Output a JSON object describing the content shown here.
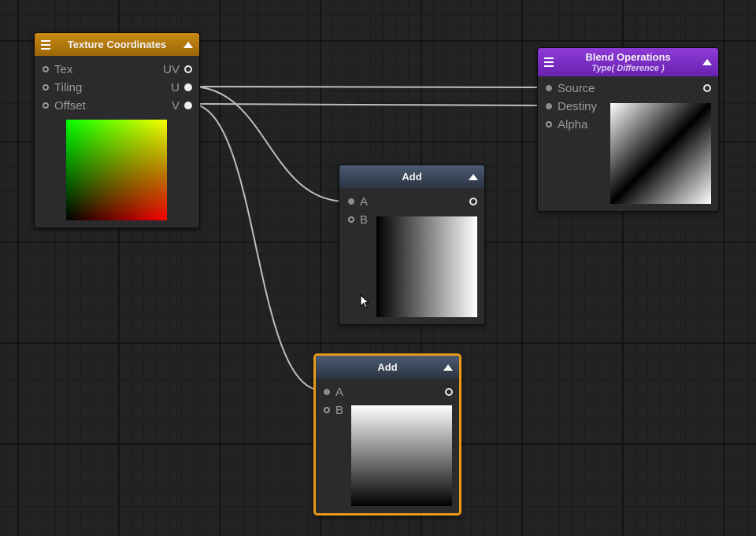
{
  "nodes": {
    "texcoord": {
      "title": "Texture Coordinates",
      "inputs": [
        "Tex",
        "Tiling",
        "Offset"
      ],
      "outputs": [
        "UV",
        "U",
        "V"
      ],
      "header_color": "#c98a12"
    },
    "blend": {
      "title": "Blend Operations",
      "subtitle": "Type( Difference )",
      "inputs": [
        "Source",
        "Destiny",
        "Alpha"
      ],
      "header_color": "#8c3ad6"
    },
    "add1": {
      "title": "Add",
      "inputs": [
        "A",
        "B"
      ],
      "header_color": "#4c5b73"
    },
    "add2": {
      "title": "Add",
      "inputs": [
        "A",
        "B"
      ],
      "header_color": "#4c5b73",
      "selected": true,
      "selection_color": "#e89a17"
    }
  },
  "icons": [
    "menu-icon",
    "collapse-arrow-icon",
    "cursor-icon"
  ]
}
